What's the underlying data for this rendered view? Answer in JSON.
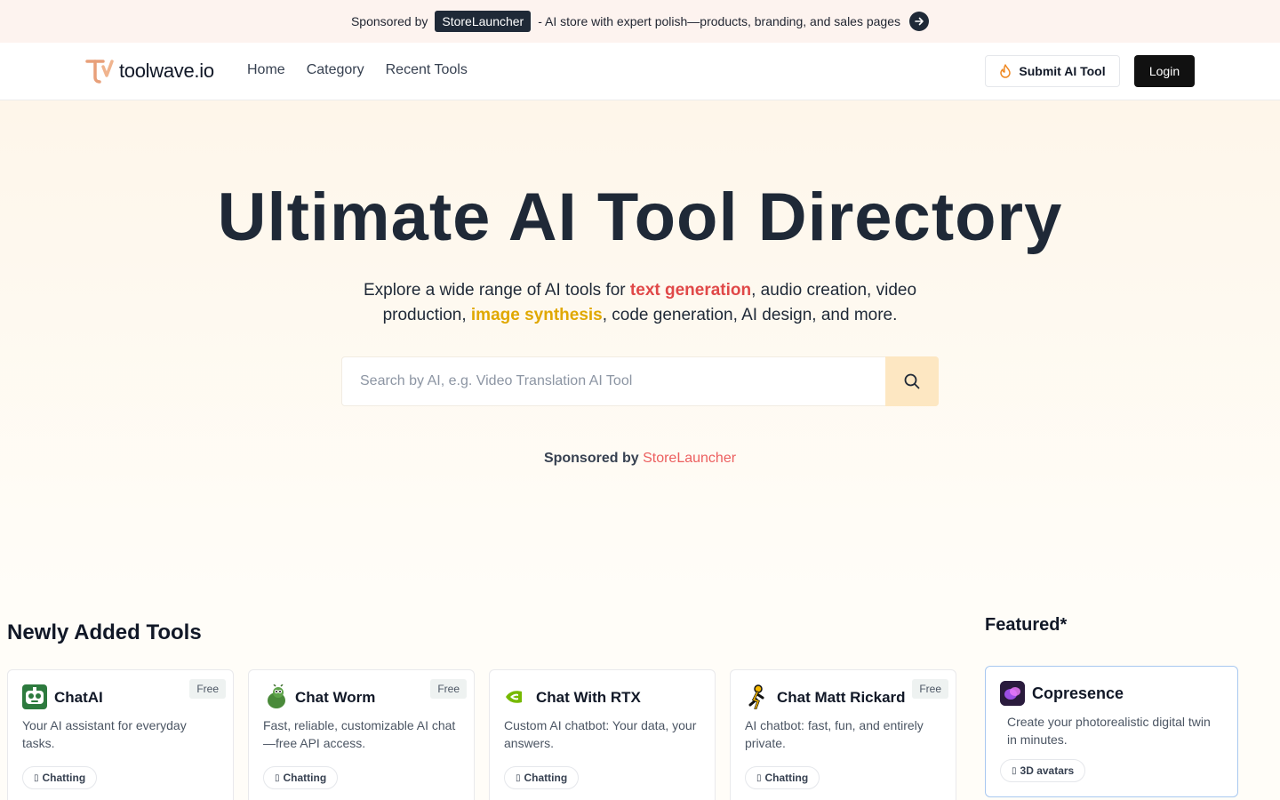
{
  "banner": {
    "label": "Sponsored by",
    "sponsor": "StoreLauncher",
    "description": "- AI store with expert polish—products, branding, and sales pages"
  },
  "header": {
    "logo_text": "toolwave.io",
    "nav": [
      "Home",
      "Category",
      "Recent Tools"
    ],
    "submit_label": "Submit AI Tool",
    "login_label": "Login"
  },
  "hero": {
    "title": "Ultimate AI Tool Directory",
    "subtitle_part1": "Explore a wide range of AI tools for ",
    "subtitle_hl1": "text generation",
    "subtitle_part2": ", audio creation, video production, ",
    "subtitle_hl2": "image synthesis",
    "subtitle_part3": ", code generation, AI design, and more.",
    "search_placeholder": "Search by AI, e.g. Video Translation AI Tool",
    "sponsored_label": "Sponsored by",
    "sponsored_brand": "StoreLauncher"
  },
  "newly_added": {
    "title": "Newly Added Tools",
    "tools": [
      {
        "name": "ChatAI",
        "price": "Free",
        "description": "Your AI assistant for everyday tasks.",
        "tag": "Chatting",
        "icon": "robot-icon"
      },
      {
        "name": "Chat Worm",
        "price": "Free",
        "description": "Fast, reliable, customizable AI chat—free API access.",
        "tag": "Chatting",
        "icon": "worm-icon"
      },
      {
        "name": "Chat With RTX",
        "price": "",
        "description": "Custom AI chatbot: Your data, your answers.",
        "tag": "Chatting",
        "icon": "nvidia-icon"
      },
      {
        "name": "Chat Matt Rickard",
        "price": "Free",
        "description": "AI chatbot: fast, fun, and entirely private.",
        "tag": "Chatting",
        "icon": "runner-icon"
      }
    ]
  },
  "featured": {
    "title": "Featured*",
    "tool": {
      "name": "Copresence",
      "description": "Create your photorealistic digital twin in minutes.",
      "tag": "3D avatars",
      "icon": "copresence-icon"
    }
  }
}
